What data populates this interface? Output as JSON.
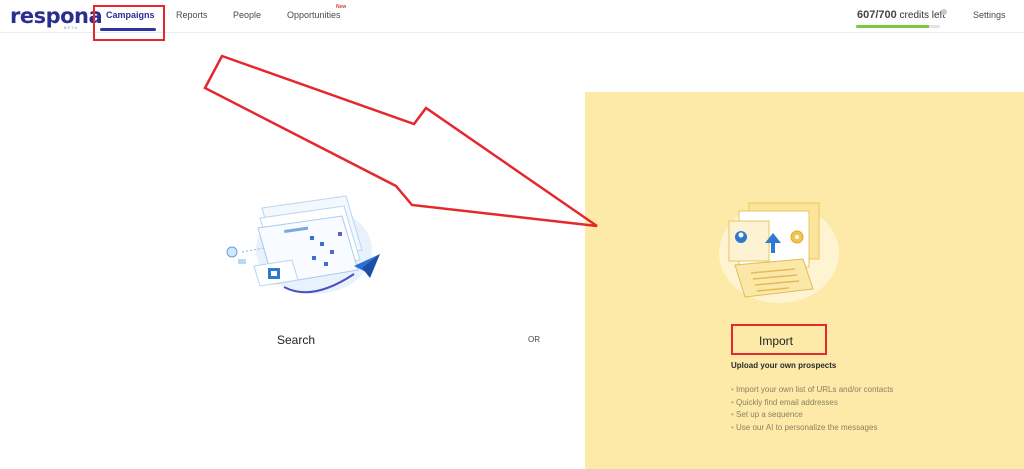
{
  "brand": {
    "name": "respona",
    "tag": "BETA"
  },
  "nav": {
    "campaigns": "Campaigns",
    "reports": "Reports",
    "people": "People",
    "opportunities": "Opportunities",
    "opportunities_badge": "New",
    "settings": "Settings"
  },
  "credits": {
    "used_total": "607/700",
    "label": "credits left",
    "fraction": 0.867
  },
  "search_option": {
    "label": "Search"
  },
  "divider": "OR",
  "import_option": {
    "label": "Import",
    "subtitle": "Upload your own prospects",
    "bullets": [
      "Import your own list of URLs and/or contacts",
      "Quickly find email addresses",
      "Set up a sequence",
      "Use our AI to personalize the messages"
    ]
  },
  "colors": {
    "brand": "#2a2f8f",
    "highlight": "#e5282e",
    "panel": "#fdeaa8",
    "progress": "#7ac943"
  },
  "icons": {
    "info": "info-icon"
  }
}
